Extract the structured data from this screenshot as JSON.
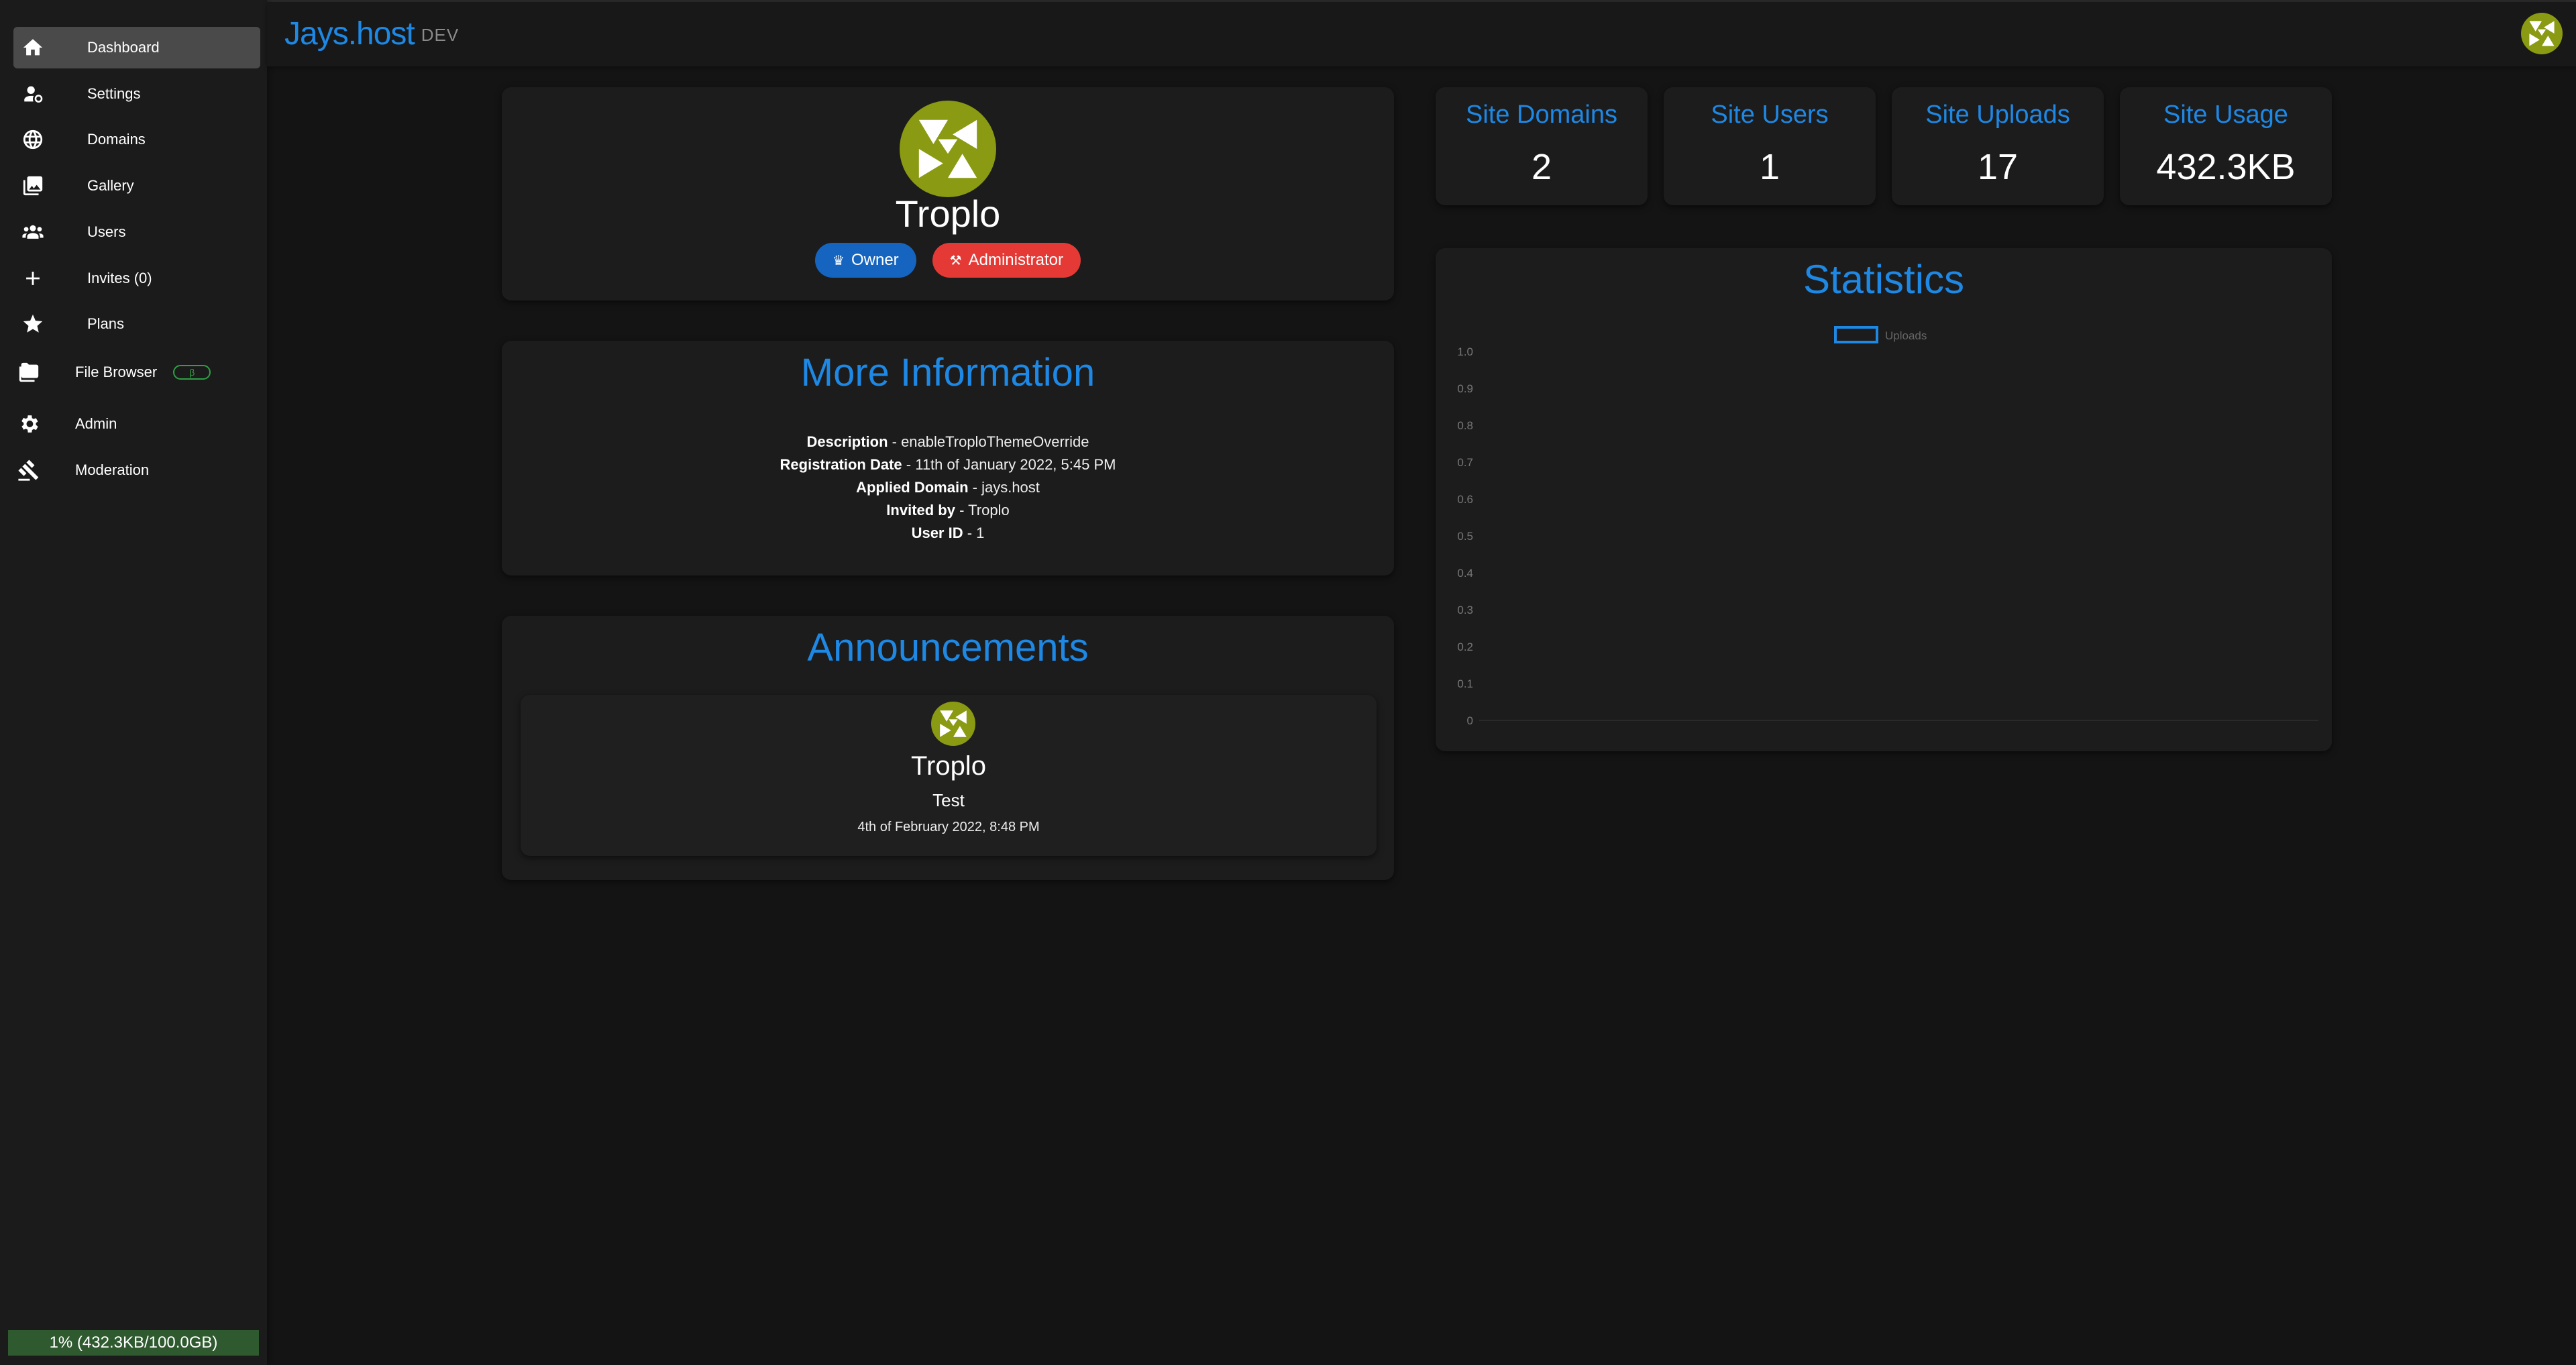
{
  "sidebar": {
    "items": [
      {
        "label": "Dashboard",
        "icon": "home-icon",
        "active": true
      },
      {
        "label": "Settings",
        "icon": "user-settings-icon"
      },
      {
        "label": "Domains",
        "icon": "globe-icon"
      },
      {
        "label": "Gallery",
        "icon": "gallery-icon"
      },
      {
        "label": "Users",
        "icon": "users-icon"
      },
      {
        "label": "Invites (0)",
        "icon": "plus-icon"
      },
      {
        "label": "Plans",
        "icon": "star-icon"
      },
      {
        "label": "File Browser",
        "icon": "folder-icon",
        "badge": "β"
      },
      {
        "label": "Admin",
        "icon": "gear-icon"
      },
      {
        "label": "Moderation",
        "icon": "gavel-icon"
      }
    ],
    "storage": "1% (432.3KB/100.0GB)"
  },
  "header": {
    "brand": "Jays.host",
    "env": "DEV"
  },
  "profile": {
    "name": "Troplo",
    "badges": [
      {
        "label": "Owner",
        "icon": "crown-icon",
        "color": "#1565c0"
      },
      {
        "label": "Administrator",
        "icon": "gavel-icon",
        "color": "#e53935"
      }
    ]
  },
  "info": {
    "title": "More Information",
    "rows": [
      {
        "label": "Description",
        "value": " - enableTroploThemeOverride"
      },
      {
        "label": "Registration Date",
        "value": " - 11th of January 2022, 5:45 PM"
      },
      {
        "label": "Applied Domain",
        "value": " - jays.host"
      },
      {
        "label": "Invited by",
        "value": " - Troplo"
      },
      {
        "label": "User ID",
        "value": " - 1"
      }
    ]
  },
  "announcements": {
    "title": "Announcements",
    "items": [
      {
        "author": "Troplo",
        "body": "Test",
        "date": "4th of February 2022, 8:48 PM"
      }
    ]
  },
  "stats": [
    {
      "title": "Site Domains",
      "value": "2"
    },
    {
      "title": "Site Users",
      "value": "1"
    },
    {
      "title": "Site Uploads",
      "value": "17"
    },
    {
      "title": "Site Usage",
      "value": "432.3KB"
    }
  ],
  "statistics": {
    "title": "Statistics"
  },
  "chart_data": {
    "type": "line",
    "title": "",
    "series": [
      {
        "name": "Uploads",
        "values": []
      }
    ],
    "x": [],
    "ylim": [
      0,
      1.0
    ],
    "yticks": [
      "1.0",
      "0.9",
      "0.8",
      "0.7",
      "0.6",
      "0.5",
      "0.4",
      "0.3",
      "0.2",
      "0.1",
      "0"
    ],
    "legend_position": "top",
    "series_color": "#1e88e5"
  },
  "colors": {
    "accent": "#1e88e5",
    "background": "#141414",
    "card": "#1c1c1c",
    "sidebar_active": "#4a4a4a",
    "storage_bar": "#2f5a2f",
    "avatar_green": "#8a9a12"
  }
}
